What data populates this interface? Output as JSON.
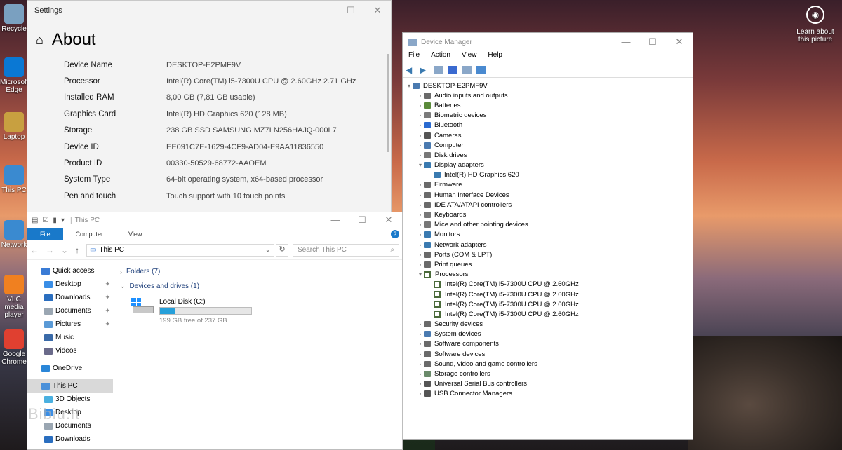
{
  "desktop": {
    "icons": [
      "Recycle",
      "Microsoft Edge",
      "Laptop",
      "This PC",
      "Network",
      "VLC media player",
      "Google Chrome"
    ],
    "learn_label": "Learn about this picture",
    "watermark": "Bibiu.lt"
  },
  "settings": {
    "window_title": "Settings",
    "page_title": "About",
    "specs": [
      {
        "key": "Device Name",
        "value": "DESKTOP-E2PMF9V"
      },
      {
        "key": "Processor",
        "value": "Intel(R) Core(TM) i5-7300U CPU @ 2.60GHz   2.71 GHz"
      },
      {
        "key": "Installed RAM",
        "value": "8,00 GB (7,81 GB usable)"
      },
      {
        "key": "Graphics Card",
        "value": "Intel(R) HD Graphics 620 (128 MB)"
      },
      {
        "key": "Storage",
        "value": "238 GB SSD SAMSUNG MZ7LN256HAJQ-000L7"
      },
      {
        "key": "Device ID",
        "value": "EE091C7E-1629-4CF9-AD04-E9AA11836550"
      },
      {
        "key": "Product ID",
        "value": "00330-50529-68772-AAOEM"
      },
      {
        "key": "System Type",
        "value": "64-bit operating system, x64-based processor"
      },
      {
        "key": "Pen and touch",
        "value": "Touch support with 10 touch points"
      }
    ]
  },
  "explorer": {
    "window_title": "This PC",
    "tabs": [
      "File",
      "Computer",
      "View"
    ],
    "address": "This PC",
    "search_placeholder": "Search This PC",
    "nav": [
      {
        "label": "Quick access",
        "type": "head",
        "color": "#3a7bd5"
      },
      {
        "label": "Desktop",
        "type": "sub",
        "pin": true,
        "color": "#3a8ee6"
      },
      {
        "label": "Downloads",
        "type": "sub",
        "pin": true,
        "color": "#2a6ebf"
      },
      {
        "label": "Documents",
        "type": "sub",
        "pin": true,
        "color": "#9aa6b2"
      },
      {
        "label": "Pictures",
        "type": "sub",
        "pin": true,
        "color": "#5a9ad6"
      },
      {
        "label": "Music",
        "type": "sub",
        "pin": false,
        "color": "#3a6aa8"
      },
      {
        "label": "Videos",
        "type": "sub",
        "pin": false,
        "color": "#6a6a8a"
      },
      {
        "label": "OneDrive",
        "type": "head",
        "color": "#2a86d8"
      },
      {
        "label": "This PC",
        "type": "head",
        "selected": true,
        "color": "#4a90d9"
      },
      {
        "label": "3D Objects",
        "type": "sub",
        "color": "#4ab0e0"
      },
      {
        "label": "Desktop",
        "type": "sub",
        "color": "#3a8ee6"
      },
      {
        "label": "Documents",
        "type": "sub",
        "color": "#9aa6b2"
      },
      {
        "label": "Downloads",
        "type": "sub",
        "color": "#2a6ebf"
      }
    ],
    "groups": {
      "folders": "Folders (7)",
      "devices": "Devices and drives (1)"
    },
    "drive": {
      "name": "Local Disk (C:)",
      "free_text": "199 GB free of 237 GB",
      "used_fraction": 0.16
    }
  },
  "device_manager": {
    "window_title": "Device Manager",
    "menu": [
      "File",
      "Action",
      "View",
      "Help"
    ],
    "root": "DESKTOP-E2PMF9V",
    "nodes": [
      {
        "label": "Audio inputs and outputs",
        "level": 1,
        "expanded": false,
        "color": "#6a6a6a"
      },
      {
        "label": "Batteries",
        "level": 1,
        "expanded": false,
        "color": "#5a8a3a"
      },
      {
        "label": "Biometric devices",
        "level": 1,
        "expanded": false,
        "color": "#7a7a7a"
      },
      {
        "label": "Bluetooth",
        "level": 1,
        "expanded": false,
        "color": "#2a6ad0"
      },
      {
        "label": "Cameras",
        "level": 1,
        "expanded": false,
        "color": "#555555"
      },
      {
        "label": "Computer",
        "level": 1,
        "expanded": false,
        "color": "#4a7ab0"
      },
      {
        "label": "Disk drives",
        "level": 1,
        "expanded": false,
        "color": "#777777"
      },
      {
        "label": "Display adapters",
        "level": 1,
        "expanded": true,
        "color": "#3a7ab0"
      },
      {
        "label": "Intel(R) HD Graphics 620",
        "level": 2,
        "color": "#3a7ab0"
      },
      {
        "label": "Firmware",
        "level": 1,
        "expanded": false,
        "color": "#6a6a6a"
      },
      {
        "label": "Human Interface Devices",
        "level": 1,
        "expanded": false,
        "color": "#6a6a6a"
      },
      {
        "label": "IDE ATA/ATAPI controllers",
        "level": 1,
        "expanded": false,
        "color": "#6a6a6a"
      },
      {
        "label": "Keyboards",
        "level": 1,
        "expanded": false,
        "color": "#777777"
      },
      {
        "label": "Mice and other pointing devices",
        "level": 1,
        "expanded": false,
        "color": "#777777"
      },
      {
        "label": "Monitors",
        "level": 1,
        "expanded": false,
        "color": "#3a7ab0"
      },
      {
        "label": "Network adapters",
        "level": 1,
        "expanded": false,
        "color": "#3a7ab0"
      },
      {
        "label": "Ports (COM & LPT)",
        "level": 1,
        "expanded": false,
        "color": "#6a6a6a"
      },
      {
        "label": "Print queues",
        "level": 1,
        "expanded": false,
        "color": "#6a6a6a"
      },
      {
        "label": "Processors",
        "level": 1,
        "expanded": true,
        "cpu": true
      },
      {
        "label": "Intel(R) Core(TM) i5-7300U CPU @ 2.60GHz",
        "level": 2,
        "cpu": true
      },
      {
        "label": "Intel(R) Core(TM) i5-7300U CPU @ 2.60GHz",
        "level": 2,
        "cpu": true
      },
      {
        "label": "Intel(R) Core(TM) i5-7300U CPU @ 2.60GHz",
        "level": 2,
        "cpu": true
      },
      {
        "label": "Intel(R) Core(TM) i5-7300U CPU @ 2.60GHz",
        "level": 2,
        "cpu": true
      },
      {
        "label": "Security devices",
        "level": 1,
        "expanded": false,
        "color": "#6a6a6a"
      },
      {
        "label": "System devices",
        "level": 1,
        "expanded": false,
        "color": "#4a7ab0"
      },
      {
        "label": "Software components",
        "level": 1,
        "expanded": false,
        "color": "#6a6a6a"
      },
      {
        "label": "Software devices",
        "level": 1,
        "expanded": false,
        "color": "#6a6a6a"
      },
      {
        "label": "Sound, video and game controllers",
        "level": 1,
        "expanded": false,
        "color": "#6a6a6a"
      },
      {
        "label": "Storage controllers",
        "level": 1,
        "expanded": false,
        "color": "#6a8a6a"
      },
      {
        "label": "Universal Serial Bus controllers",
        "level": 1,
        "expanded": false,
        "color": "#555555"
      },
      {
        "label": "USB Connector Managers",
        "level": 1,
        "expanded": false,
        "color": "#555555"
      }
    ]
  }
}
